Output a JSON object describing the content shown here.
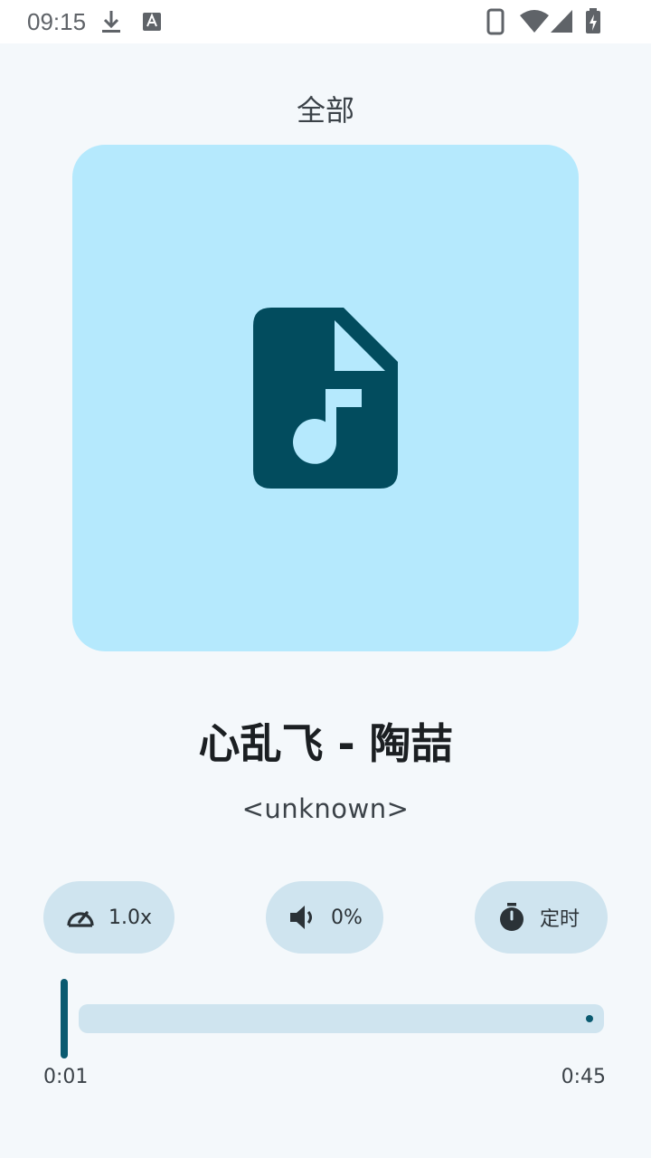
{
  "status_bar": {
    "time": "09:15",
    "icons": [
      "download-icon",
      "font-a-icon",
      "phone-icon",
      "wifi-icon",
      "signal-icon",
      "battery-charging-icon"
    ]
  },
  "header": {
    "title": "全部"
  },
  "artwork": {
    "icon": "audio-file-icon",
    "background": "#b5e9fd",
    "icon_color": "#024c5e"
  },
  "song": {
    "title": "心乱飞 - 陶喆",
    "artist": "<unknown>"
  },
  "controls": {
    "speed": {
      "icon": "speedometer-icon",
      "label": "1.0x"
    },
    "volume": {
      "icon": "volume-icon",
      "label": "0%"
    },
    "timer": {
      "icon": "stopwatch-icon",
      "label": "定时"
    }
  },
  "progress": {
    "current": "0:01",
    "total": "0:45",
    "accent": "#0a5a70",
    "track": "#cfe4ef"
  }
}
